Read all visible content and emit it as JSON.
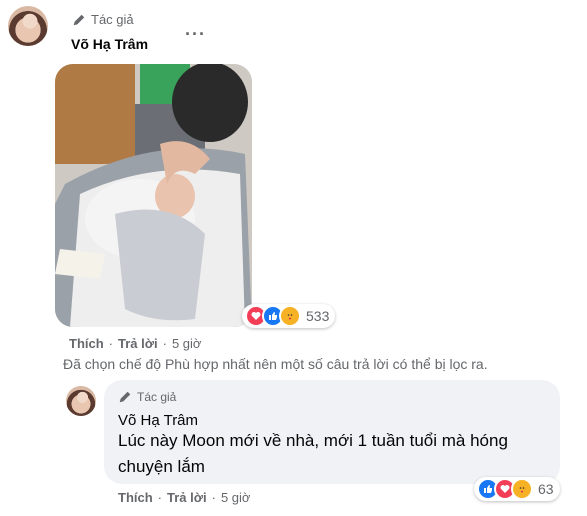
{
  "comment1": {
    "author_tag": "Tác giả",
    "author_name": "Võ Hạ Trâm",
    "actions": {
      "like": "Thích",
      "reply": "Trả lời",
      "time": "5 giờ"
    },
    "reactions": {
      "icons": [
        "love-icon",
        "like-icon",
        "care-icon"
      ],
      "count": "533"
    }
  },
  "filter_notice": "Đã chọn chế độ Phù hợp nhất nên một số câu trả lời có thể bị lọc ra.",
  "reply1": {
    "author_tag": "Tác giả",
    "author_name": "Võ Hạ Trâm",
    "text": "Lúc này Moon mới về nhà, mới 1 tuần tuổi mà hóng chuyện lắm",
    "actions": {
      "like": "Thích",
      "reply": "Trả lời",
      "time": "5 giờ"
    },
    "reactions": {
      "icons": [
        "like-icon",
        "love-icon",
        "care-icon"
      ],
      "count": "63"
    }
  },
  "colors": {
    "like": "#1877f2",
    "love": "#f33e58",
    "care": "#f7b125",
    "meta": "#65676b",
    "bubble": "#f0f2f5"
  }
}
